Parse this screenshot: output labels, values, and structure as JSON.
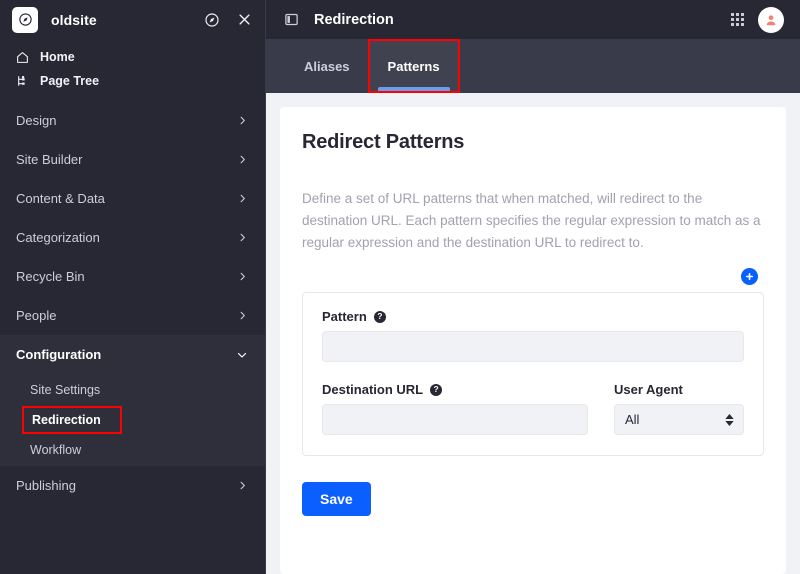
{
  "sidebar": {
    "site_name": "oldsite",
    "logo_icon": "compass-icon",
    "header_actions": [
      {
        "icon": "compass-icon",
        "name": "explore-icon"
      },
      {
        "icon": "close-icon",
        "name": "close-icon"
      }
    ],
    "quick_items": [
      {
        "label": "Home",
        "icon": "home-icon"
      },
      {
        "label": "Page Tree",
        "icon": "page-tree-icon"
      }
    ],
    "nav_items": [
      {
        "label": "Design",
        "expanded": false
      },
      {
        "label": "Site Builder",
        "expanded": false
      },
      {
        "label": "Content & Data",
        "expanded": false
      },
      {
        "label": "Categorization",
        "expanded": false
      },
      {
        "label": "Recycle Bin",
        "expanded": false
      },
      {
        "label": "People",
        "expanded": false
      },
      {
        "label": "Configuration",
        "expanded": true
      },
      {
        "label": "Publishing",
        "expanded": false
      }
    ],
    "configuration_children": [
      {
        "label": "Site Settings",
        "active": false,
        "highlighted": false
      },
      {
        "label": "Redirection",
        "active": true,
        "highlighted": true
      },
      {
        "label": "Workflow",
        "active": false,
        "highlighted": false
      }
    ]
  },
  "topbar": {
    "panel_icon": "sidebar-toggle-icon",
    "title": "Redirection",
    "grid_icon": "app-grid-icon",
    "avatar_icon": "user-avatar-icon"
  },
  "tabs": [
    {
      "label": "Aliases",
      "active": false,
      "highlighted": false
    },
    {
      "label": "Patterns",
      "active": true,
      "highlighted": true
    }
  ],
  "main": {
    "card_title": "Redirect Patterns",
    "card_description": "Define a set of URL patterns that when matched, will redirect to the destination URL. Each pattern specifies the regular expression to match as a regular expression and the destination URL to redirect to.",
    "add_button_label": "+",
    "pattern_field": {
      "label": "Pattern",
      "help_icon": "help-icon",
      "value": "",
      "placeholder": ""
    },
    "destination_field": {
      "label": "Destination URL",
      "help_icon": "help-icon",
      "value": "",
      "placeholder": ""
    },
    "user_agent_field": {
      "label": "User Agent",
      "value": "All",
      "options": [
        "All"
      ]
    },
    "save_label": "Save"
  },
  "colors": {
    "sidebar_bg": "#272833",
    "sidebar_group_open_bg": "#2e2f3b",
    "tabbar_bg": "#393a4a",
    "accent_blue": "#0b5fff",
    "tab_underline": "#6b9cf0",
    "highlight_red": "#ff0000",
    "page_bg": "#f1f2f5"
  }
}
